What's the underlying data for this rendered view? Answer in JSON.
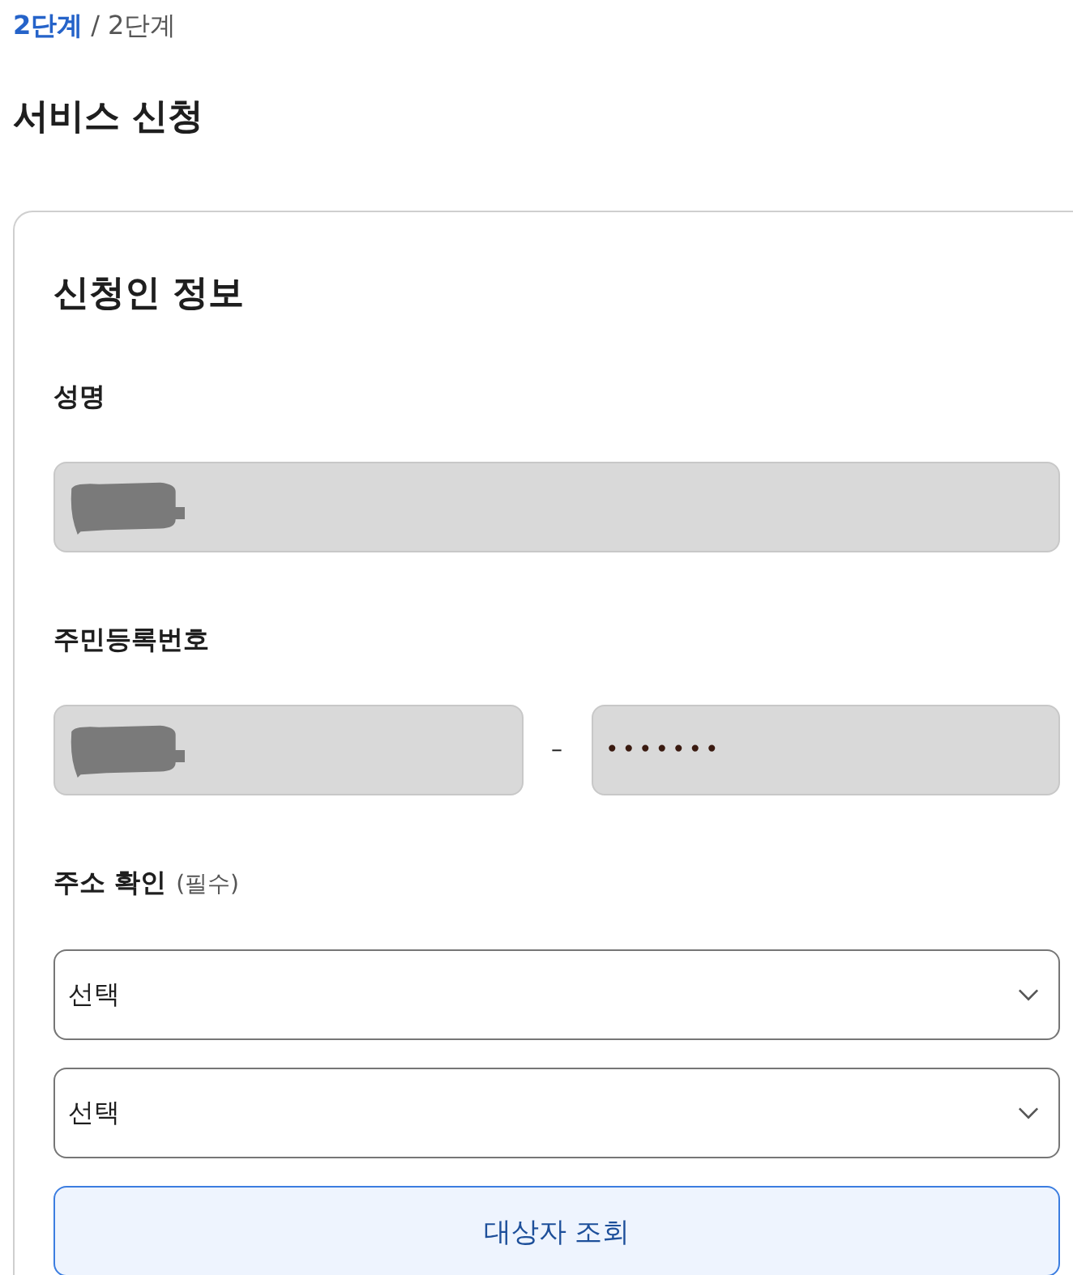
{
  "breadcrumb": {
    "current": "2단계",
    "separator": "/",
    "total": "2단계"
  },
  "page_title": "서비스 신청",
  "section": {
    "title": "신청인 정보",
    "fields": [
      {
        "kind": "text",
        "label": "성명",
        "disabled": true,
        "redacted": true
      },
      {
        "kind": "split",
        "label": "주민등록번호",
        "first": {
          "disabled": true,
          "redacted": true
        },
        "separator": "–",
        "second": {
          "disabled": true,
          "value": "•••••••"
        }
      },
      {
        "kind": "selects",
        "label": "주소 확인",
        "note": "(필수)",
        "selects": [
          {
            "value": "선택"
          },
          {
            "value": "선택"
          }
        ]
      }
    ],
    "button": "대상자 조회"
  }
}
